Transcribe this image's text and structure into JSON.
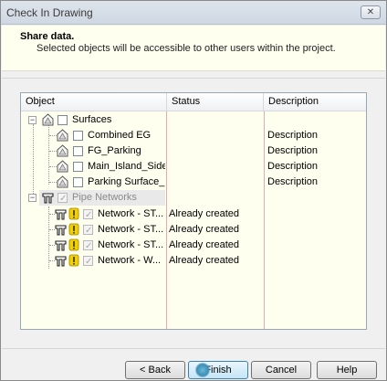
{
  "window": {
    "title": "Check In Drawing",
    "close_label": "✕"
  },
  "header": {
    "title": "Share data.",
    "subtitle": "Selected objects will be accessible to other users within the project."
  },
  "table": {
    "columns": [
      "Object",
      "Status",
      "Description"
    ],
    "groups": [
      {
        "label": "Surfaces",
        "enabled": true,
        "icon": "surface-icon",
        "items": [
          {
            "name": "Combined EG",
            "status": "",
            "description": "Description"
          },
          {
            "name": "FG_Parking",
            "status": "",
            "description": "Description"
          },
          {
            "name": "Main_Island_Side...",
            "status": "",
            "description": "Description"
          },
          {
            "name": "Parking Surface_...",
            "status": "",
            "description": "Description"
          }
        ]
      },
      {
        "label": "Pipe Networks",
        "enabled": false,
        "icon": "pipe-network-icon",
        "items": [
          {
            "name": "Network - ST...",
            "status": "Already created",
            "description": "",
            "warning": true
          },
          {
            "name": "Network - ST...",
            "status": "Already created",
            "description": "",
            "warning": true
          },
          {
            "name": "Network - ST...",
            "status": "Already created",
            "description": "",
            "warning": true
          },
          {
            "name": "Network - W...",
            "status": "Already created",
            "description": "",
            "warning": true
          }
        ]
      }
    ]
  },
  "buttons": {
    "back": "< Back",
    "finish": "Finish",
    "cancel": "Cancel",
    "help": "Help"
  },
  "colors": {
    "panel_bg": "#fffff0",
    "column_divider": "#e8a9b0",
    "finish_border": "#3c7fb1"
  }
}
